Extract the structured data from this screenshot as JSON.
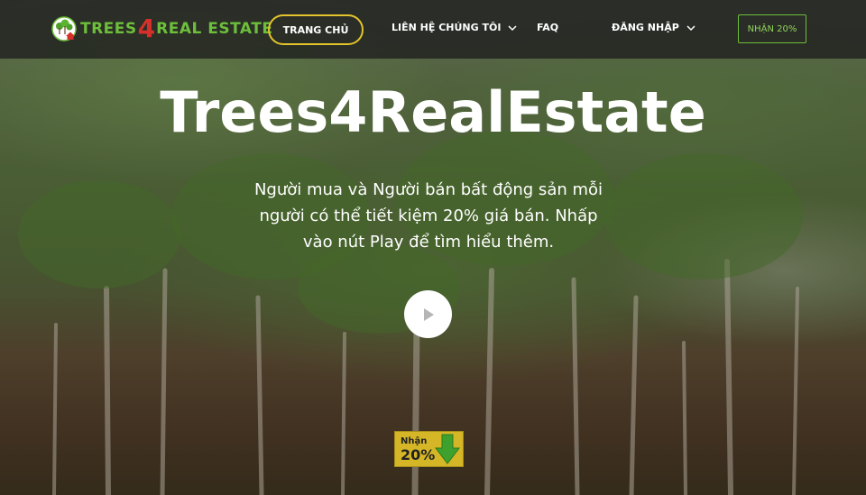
{
  "brand": {
    "name_part1": "TREES",
    "name_digit": "4",
    "name_part2": "REAL ESTATE",
    "logo_icon": "tree-house-logo-icon",
    "colors": {
      "green": "#6dbf3b",
      "red": "#d6302a"
    }
  },
  "nav": {
    "home_label": "TRANG CHỦ",
    "contact_label": "LIÊN HỆ CHÚNG TÔI",
    "faq_label": "FAQ",
    "login_label": "ĐĂNG NHẬP",
    "cta_label": "NHẬN 20%",
    "home_border_color": "#e3c42c"
  },
  "hero": {
    "title": "Trees4RealEstate",
    "subtitle": "Người mua và Người bán bất động sản mỗi người có thể tiết kiệm 20% giá bán. Nhấp vào nút Play để tìm hiểu thêm.",
    "play_icon": "play-icon"
  },
  "badge": {
    "label_top": "Nhận",
    "label_main": "20%",
    "arrow_icon": "arrow-down-icon",
    "color": "#d4b626"
  }
}
